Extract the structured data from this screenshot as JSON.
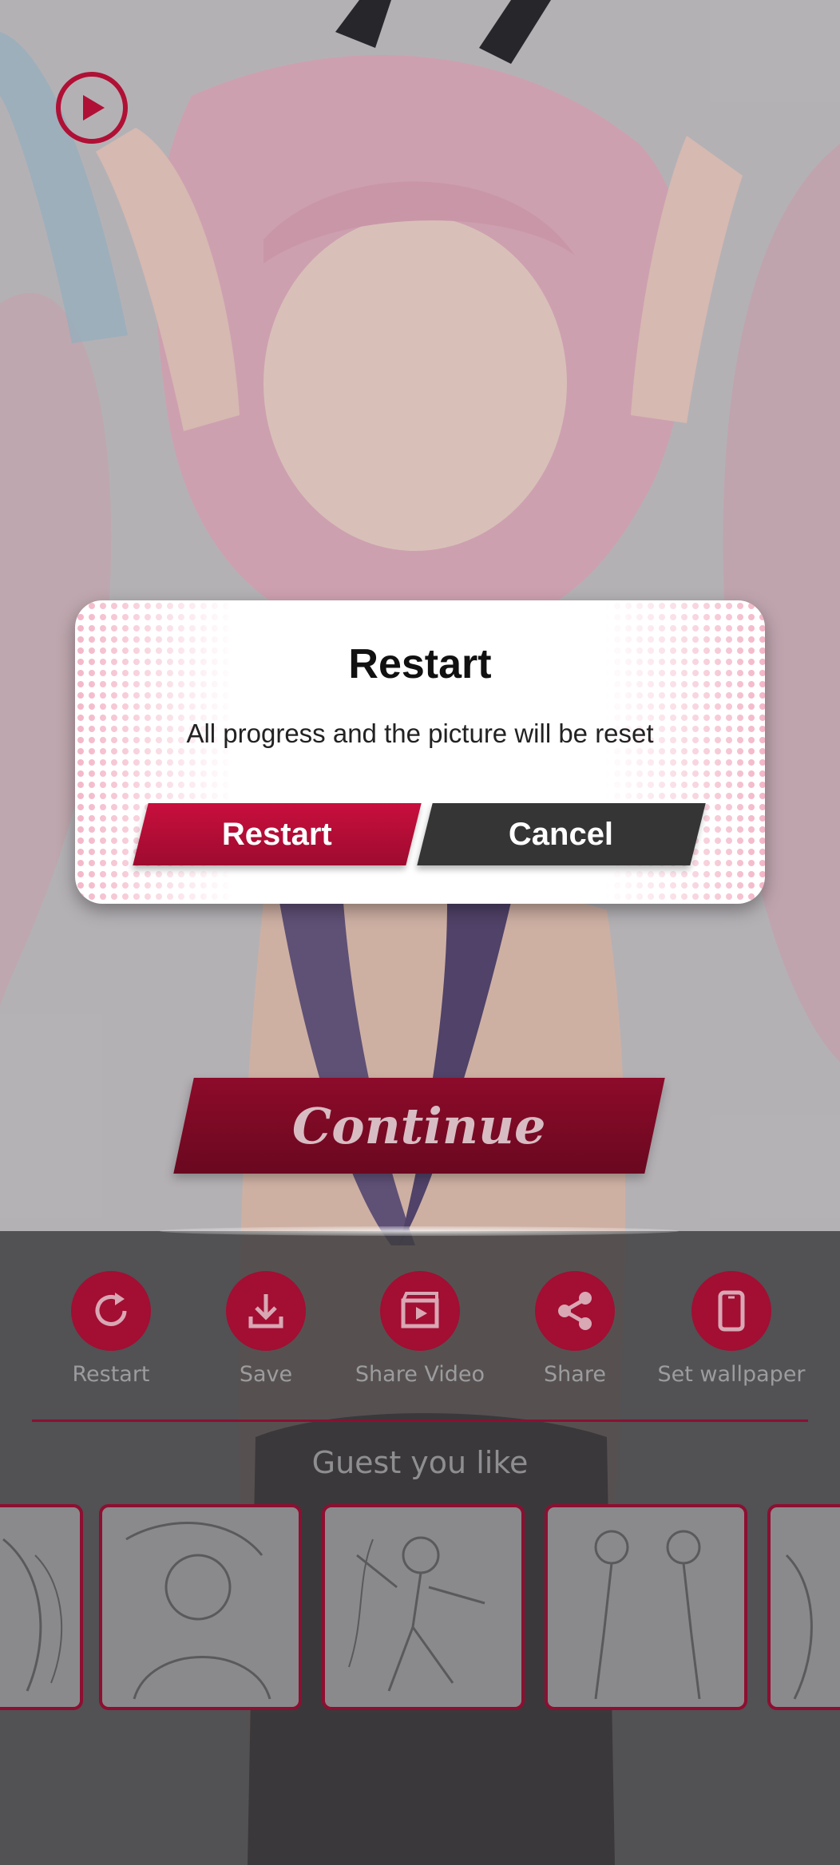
{
  "dialog": {
    "title": "Restart",
    "message": "All progress and the picture will be reset",
    "confirm_label": "Restart",
    "cancel_label": "Cancel"
  },
  "continue_label": "Continue",
  "actions": [
    {
      "label": "Restart",
      "icon": "restart-icon"
    },
    {
      "label": "Save",
      "icon": "download-icon"
    },
    {
      "label": "Share Video",
      "icon": "video-icon"
    },
    {
      "label": "Share",
      "icon": "share-icon"
    },
    {
      "label": "Set wallpaper",
      "icon": "phone-icon"
    }
  ],
  "recommendations": {
    "title": "Guest you like"
  },
  "colors": {
    "accent": "#a30e33",
    "dark_button": "#353536",
    "panel": "#3c3c3e"
  }
}
